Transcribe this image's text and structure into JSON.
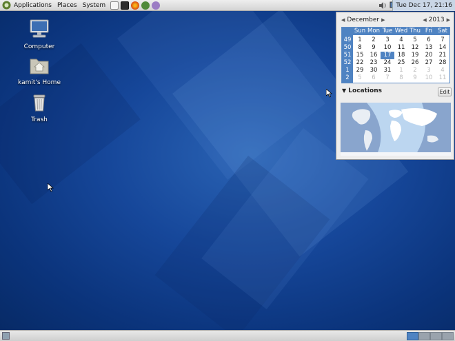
{
  "top_panel": {
    "menus": [
      "Applications",
      "Places",
      "System"
    ],
    "clock": "Tue Dec 17, 21:16"
  },
  "desktop_icons": [
    {
      "label": "Computer"
    },
    {
      "label": "kamit's Home"
    },
    {
      "label": "Trash"
    }
  ],
  "calendar": {
    "month": "December",
    "year": "2013",
    "day_headers": [
      "Sun",
      "Mon",
      "Tue",
      "Wed",
      "Thu",
      "Fri",
      "Sat"
    ],
    "week_numbers": [
      "49",
      "50",
      "51",
      "52",
      "1",
      "2"
    ],
    "weeks": [
      [
        "1",
        "2",
        "3",
        "4",
        "5",
        "6",
        "7"
      ],
      [
        "8",
        "9",
        "10",
        "11",
        "12",
        "13",
        "14"
      ],
      [
        "15",
        "16",
        "17",
        "18",
        "19",
        "20",
        "21"
      ],
      [
        "22",
        "23",
        "24",
        "25",
        "26",
        "27",
        "28"
      ],
      [
        "29",
        "30",
        "31",
        "1",
        "2",
        "3",
        "4"
      ],
      [
        "5",
        "6",
        "7",
        "8",
        "9",
        "10",
        "11"
      ]
    ],
    "today": "17"
  },
  "locations": {
    "title": "Locations",
    "edit_label": "Edit"
  },
  "colors": {
    "panel": "#e0e0e0",
    "desktop": "#16479a",
    "calendar_accent": "#4f83c2"
  }
}
